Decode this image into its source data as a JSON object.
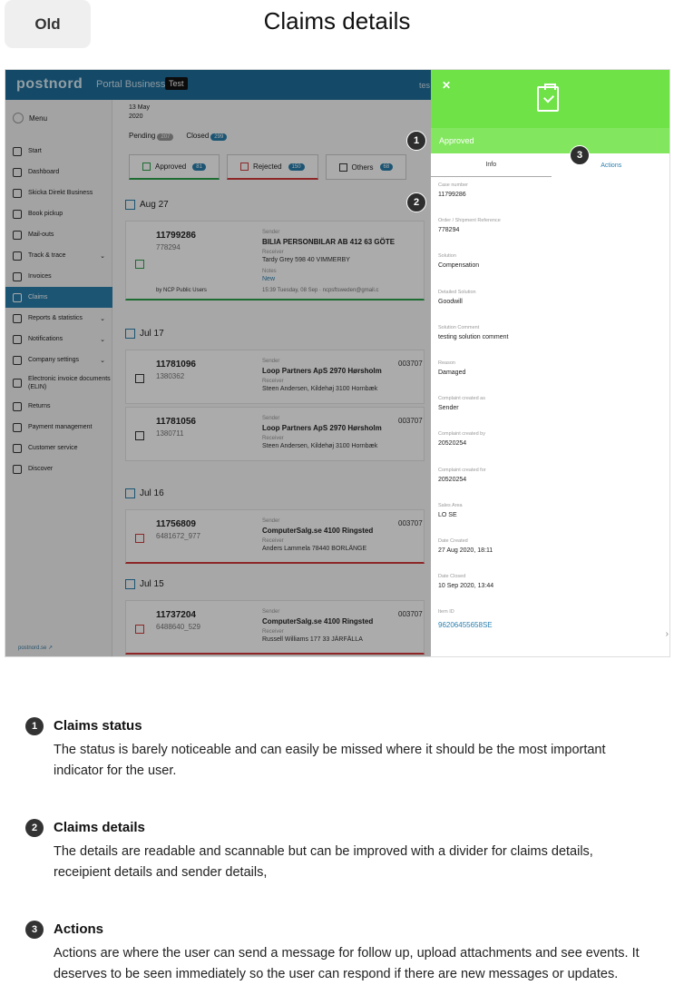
{
  "header": {
    "tag": "Old",
    "title": "Claims details"
  },
  "app": {
    "logo": "postnord",
    "portal": "Portal Business",
    "test_badge": "Test",
    "user": "tes",
    "menu_label": "Menu",
    "nav": [
      {
        "label": "Start",
        "icon": "home-icon"
      },
      {
        "label": "Dashboard",
        "icon": "dashboard-icon"
      },
      {
        "label": "Skicka Direkt Business",
        "icon": "send-icon"
      },
      {
        "label": "Book pickup",
        "icon": "truck-icon"
      },
      {
        "label": "Mail-outs",
        "icon": "mail-icon"
      },
      {
        "label": "Track & trace",
        "icon": "track-icon",
        "chev": true
      },
      {
        "label": "Invoices",
        "icon": "invoice-icon"
      },
      {
        "label": "Claims",
        "icon": "claims-icon",
        "active": true
      },
      {
        "label": "Reports & statistics",
        "icon": "chart-icon",
        "chev": true
      },
      {
        "label": "Notifications",
        "icon": "bell-icon",
        "chev": true
      },
      {
        "label": "Company settings",
        "icon": "gear-icon",
        "chev": true
      },
      {
        "label": "Electronic invoice documents (ELIN)",
        "icon": "document-icon",
        "tall": true
      },
      {
        "label": "Returns",
        "icon": "return-icon"
      },
      {
        "label": "Payment management",
        "icon": "payment-icon"
      },
      {
        "label": "Customer service",
        "icon": "chat-icon"
      },
      {
        "label": "Discover",
        "icon": "compass-icon"
      }
    ],
    "site_link": "postnord.se ↗",
    "date_line1": "13 May",
    "date_line2": "2020",
    "status_tabs": [
      {
        "label": "Pending",
        "count": "207",
        "grey": true
      },
      {
        "label": "Closed",
        "count": "299"
      }
    ],
    "filters": [
      {
        "label": "Approved",
        "count": "81"
      },
      {
        "label": "Rejected",
        "count": "150"
      },
      {
        "label": "Others",
        "count": "68"
      }
    ],
    "groups": [
      {
        "date": "Aug 27",
        "cards": [
          {
            "case": "11799286",
            "ref": "778294",
            "sender_label": "Sender",
            "sender": "BILIA PERSONBILAR AB 412 63 GÖTE",
            "receiver_label": "Receiver",
            "receiver": "Tardy Grey 598 40 VIMMERBY",
            "notes_label": "Notes",
            "notes": "New",
            "by": "by NCP Public Users",
            "time": "15:39 Tuesday, 08 Sep · ncpsftsweden@gmail.c"
          }
        ]
      },
      {
        "date": "Jul 17",
        "cards": [
          {
            "case": "11781096",
            "ref": "1380362",
            "sender_label": "Sender",
            "sender": "Loop Partners ApS 2970 Hørsholm",
            "receiver_label": "Receiver",
            "receiver": "Steen Andersen, Kildehøj 3100 Hornbæk",
            "extra": "003707"
          },
          {
            "case": "11781056",
            "ref": "1380711",
            "sender_label": "Sender",
            "sender": "Loop Partners ApS 2970 Hørsholm",
            "receiver_label": "Receiver",
            "receiver": "Steen Andersen, Kildehøj 3100 Hornbæk",
            "extra": "003707"
          }
        ]
      },
      {
        "date": "Jul 16",
        "cards": [
          {
            "case": "11756809",
            "ref": "6481672_977",
            "sender_label": "Sender",
            "sender": "ComputerSalg.se 4100 Ringsted",
            "receiver_label": "Receiver",
            "receiver": "Anders Lammela 78440 BORLÄNGE",
            "extra": "003707"
          }
        ]
      },
      {
        "date": "Jul 15",
        "cards": [
          {
            "case": "11737204",
            "ref": "6488640_529",
            "sender_label": "Sender",
            "sender": "ComputerSalg.se 4100 Ringsted",
            "receiver_label": "Receiver",
            "receiver": "Russell Williams 177 33 JÄRFÄLLA",
            "extra": "003707"
          }
        ]
      }
    ]
  },
  "panel": {
    "status": "Approved",
    "tab_info": "Info",
    "tab_actions": "Actions",
    "fields": [
      {
        "label": "Case number",
        "value": "11799286"
      },
      {
        "label": "Order / Shipment Reference",
        "value": "778294"
      },
      {
        "label": "Solution",
        "value": "Compensation"
      },
      {
        "label": "Detailed Solution",
        "value": "Goodwill"
      },
      {
        "label": "Solution Comment",
        "value": "testing solution comment"
      },
      {
        "label": "Reason",
        "value": "Damaged"
      },
      {
        "label": "Complaint created as",
        "value": "Sender"
      },
      {
        "label": "Complaint created by",
        "value": "20520254"
      },
      {
        "label": "Complaint created for",
        "value": "20520254"
      },
      {
        "label": "Sales Area",
        "value": "LO SE"
      },
      {
        "label": "Date Created",
        "value": "27 Aug 2020, 18:11"
      },
      {
        "label": "Date Closed",
        "value": "10 Sep 2020, 13:44"
      }
    ],
    "item_label": "Item ID",
    "item_value": "96206455658SE",
    "item_arrow": "›"
  },
  "markers": [
    "1",
    "2",
    "3"
  ],
  "annotations": [
    {
      "num": "1",
      "title": "Claims status",
      "text": "The status is barely noticeable and can easily be missed where it should be the most important indicator for the user."
    },
    {
      "num": "2",
      "title": "Claims details",
      "text": "The details are readable and scannable but can be improved with a divider for claims details, receipient details and sender details,"
    },
    {
      "num": "3",
      "title": "Actions",
      "text": "Actions are where the user can send a message for follow up, upload attachments and see events. It deserves to be seen immediately so the user can respond if there are new messages or updates."
    }
  ],
  "colors": {
    "approved": "#6ee246",
    "brand": "#1e6e9c",
    "link": "#2a7fae",
    "rejected": "#d23b3b"
  }
}
